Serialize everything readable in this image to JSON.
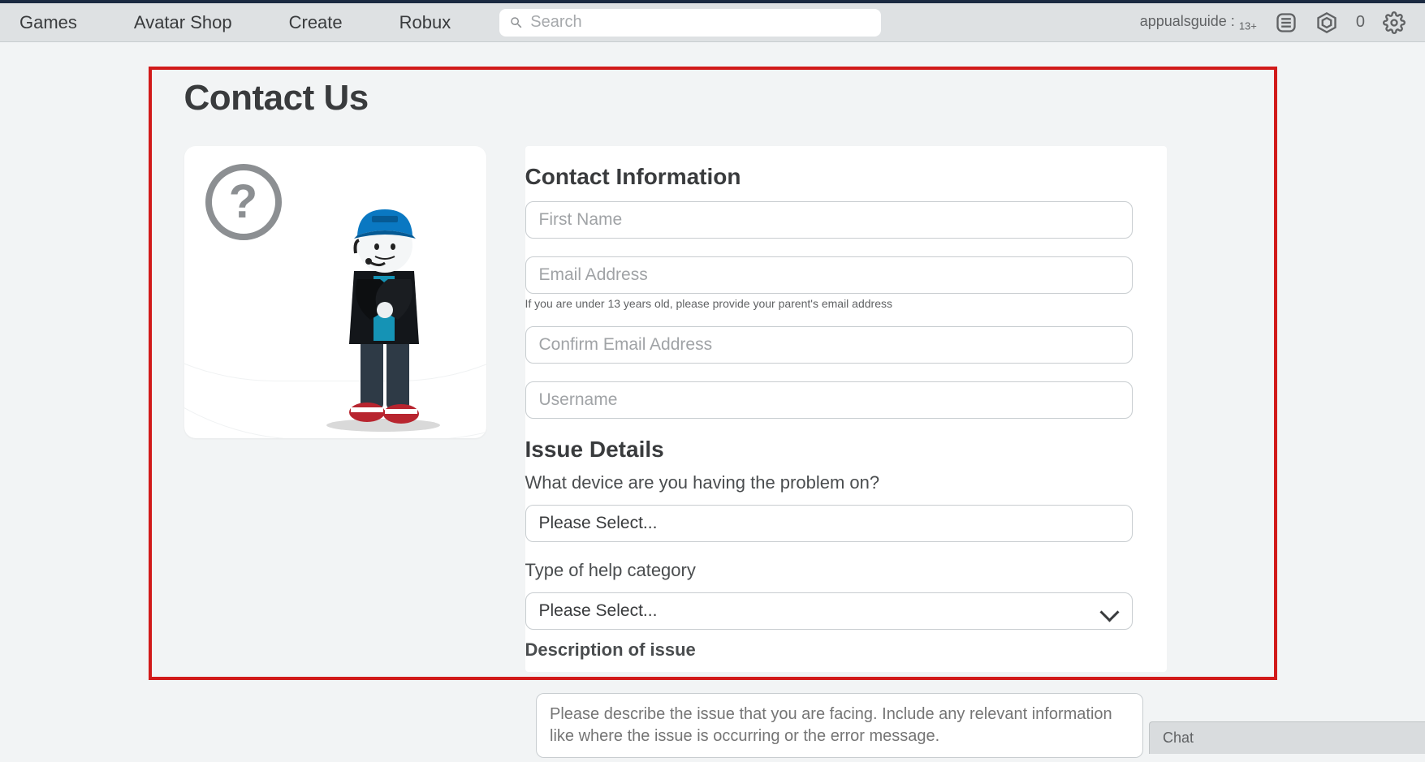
{
  "nav": {
    "games": "Games",
    "avatar_shop": "Avatar Shop",
    "create": "Create",
    "robux": "Robux"
  },
  "search": {
    "placeholder": "Search"
  },
  "user": {
    "name": "appualsguide",
    "age_sep": " : ",
    "age_badge": "13+"
  },
  "robux_count": "0",
  "page": {
    "title": "Contact Us"
  },
  "contact_info": {
    "heading": "Contact Information",
    "first_name_ph": "First Name",
    "email_ph": "Email Address",
    "email_helper": "If you are under 13 years old, please provide your parent's email address",
    "confirm_email_ph": "Confirm Email Address",
    "username_ph": "Username"
  },
  "issue": {
    "heading": "Issue Details",
    "device_label": "What device are you having the problem on?",
    "device_select": "Please Select...",
    "category_label": "Type of help category",
    "category_select": "Please Select...",
    "description_label": "Description of issue",
    "description_ph": "Please describe the issue that you are facing. Include any relevant information like where the issue is occurring or the error message."
  },
  "chat": {
    "label": "Chat"
  }
}
